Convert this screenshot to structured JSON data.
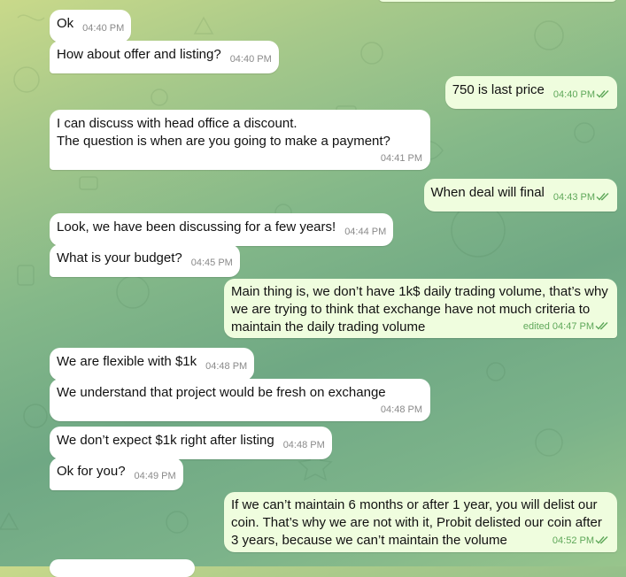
{
  "chat": {
    "messages": [
      {
        "id": "m1",
        "dir": "in",
        "text": "Ok",
        "time": "04:40 PM"
      },
      {
        "id": "m2",
        "dir": "in",
        "text": "How about offer and listing?",
        "time": "04:40 PM"
      },
      {
        "id": "m3",
        "dir": "out",
        "text": "750 is last price",
        "time": "04:40 PM"
      },
      {
        "id": "m4",
        "dir": "in",
        "text": "I can discuss with head office a discount.\nThe question is when are you going to make a payment?",
        "time": "04:41 PM"
      },
      {
        "id": "m5",
        "dir": "out",
        "text": "When deal will final",
        "time": "04:43 PM"
      },
      {
        "id": "m6",
        "dir": "in",
        "text": "Look, we have been discussing for a few years!",
        "time": "04:44 PM"
      },
      {
        "id": "m7",
        "dir": "in",
        "text": "What is your budget?",
        "time": "04:45 PM"
      },
      {
        "id": "m8",
        "dir": "out",
        "text": "Main thing is, we don’t have 1k$ daily trading volume, that’s why we are trying to think that exchange have not much criteria to maintain the daily trading volume",
        "edited": "edited",
        "time": "04:47 PM"
      },
      {
        "id": "m9",
        "dir": "in",
        "text": "We are flexible with $1k",
        "time": "04:48 PM"
      },
      {
        "id": "m10",
        "dir": "in",
        "text": "We understand that project would be fresh on exchange",
        "time": "04:48 PM"
      },
      {
        "id": "m11",
        "dir": "in",
        "text": "We don’t expect $1k right after listing",
        "time": "04:48 PM"
      },
      {
        "id": "m12",
        "dir": "in",
        "text": "Ok for you?",
        "time": "04:49 PM"
      },
      {
        "id": "m13",
        "dir": "out",
        "text": "If we can’t maintain 6 months or after 1 year, you will delist our coin. That’s why we are not with it, Probit delisted our coin after 3 years, because we can’t maintain the volume",
        "time": "04:52 PM"
      }
    ],
    "read_receipt_icon": "double-check-icon",
    "colors": {
      "incoming_bubble": "#ffffff",
      "outgoing_bubble": "#effdde",
      "outgoing_meta": "#5fa85a",
      "incoming_meta": "#8a8a8a"
    }
  }
}
